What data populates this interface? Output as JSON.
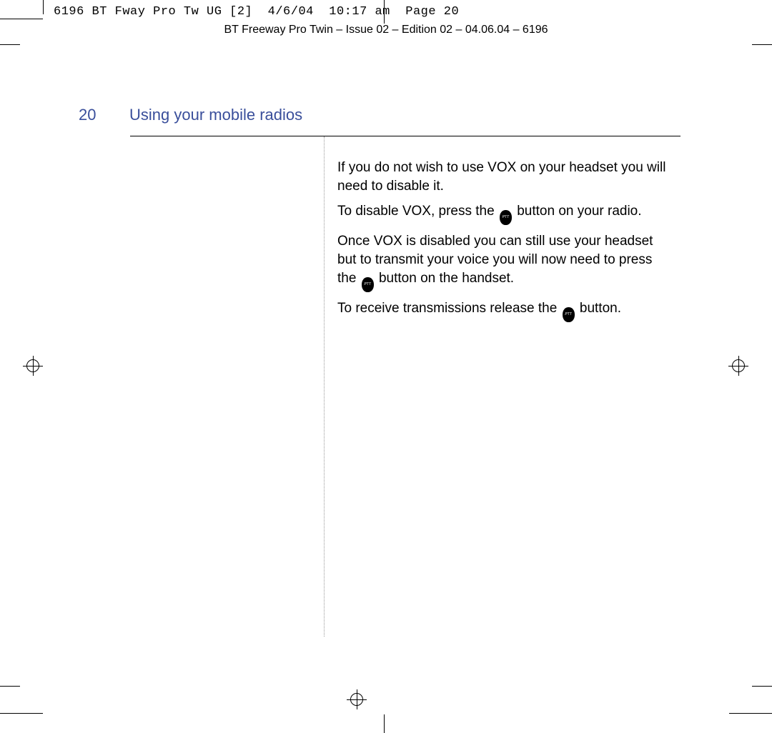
{
  "header": {
    "meta_line": "6196 BT Fway Pro Tw UG [2]  4/6/04  10:17 am  Page 20",
    "doc_title": "BT Freeway Pro Twin – Issue 02 – Edition 02 – 04.06.04 – 6196"
  },
  "page": {
    "number": "20",
    "section_title": "Using your mobile radios"
  },
  "body": {
    "p1": "If you do not wish to use VOX on your headset you will need to disable it.",
    "p2_before": "To disable VOX, press the ",
    "p2_after": " button on your radio.",
    "p3_before": "Once VOX is disabled you can still use your headset but to transmit your voice you will now need to press the ",
    "p3_after": " button on the handset.",
    "p4_before": "To receive transmissions release the ",
    "p4_after": " button.",
    "icon_label": "PTT"
  }
}
